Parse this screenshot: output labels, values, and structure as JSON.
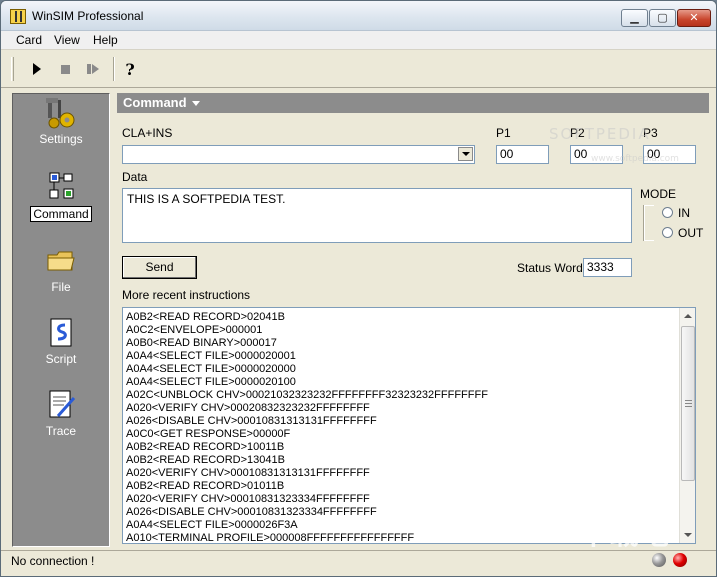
{
  "window": {
    "title": "WinSIM Professional",
    "min_glyph": "▁",
    "max_glyph": "▢",
    "close_glyph": "✕"
  },
  "menu": {
    "items": [
      "Card",
      "View",
      "Help"
    ]
  },
  "toolbar": {
    "buttons": [
      {
        "icon": "play-icon",
        "enabled": true
      },
      {
        "icon": "stop-icon",
        "enabled": false
      },
      {
        "icon": "step-icon",
        "enabled": false
      },
      {
        "icon": "help-icon",
        "enabled": true,
        "glyph": "?"
      }
    ]
  },
  "sidebar": {
    "items": [
      {
        "label": "Settings",
        "icon": "settings-icon",
        "active": false
      },
      {
        "label": "Command",
        "icon": "command-icon",
        "active": true
      },
      {
        "label": "File",
        "icon": "folder-icon",
        "active": false
      },
      {
        "label": "Script",
        "icon": "script-icon",
        "active": false
      },
      {
        "label": "Trace",
        "icon": "trace-icon",
        "active": false
      }
    ]
  },
  "command": {
    "header": "Command",
    "cla_ins_label": "CLA+INS",
    "cla_ins_value": "",
    "p1_label": "P1",
    "p1_value": "00",
    "p2_label": "P2",
    "p2_value": "00",
    "p3_label": "P3",
    "p3_value": "00",
    "data_label": "Data",
    "data_value": "THIS IS A SOFTPEDIA TEST.",
    "mode_label": "MODE",
    "mode_in": "IN",
    "mode_out": "OUT",
    "send_label": "Send",
    "status_word_label": "Status Word",
    "status_word_value": "3333",
    "recent_label": "More recent instructions",
    "recent_lines": [
      "A0B2<READ RECORD>02041B",
      "A0C2<ENVELOPE>000001",
      "A0B0<READ BINARY>000017",
      "A0A4<SELECT FILE>0000020001",
      "A0A4<SELECT FILE>0000020000",
      "A0A4<SELECT FILE>0000020100",
      "A02C<UNBLOCK CHV>00021032323232FFFFFFFF32323232FFFFFFFF",
      "A020<VERIFY CHV>00020832323232FFFFFFFF",
      "A026<DISABLE CHV>00010831313131FFFFFFFF",
      "A0C0<GET RESPONSE>00000F",
      "A0B2<READ RECORD>10011B",
      "A0B2<READ RECORD>13041B",
      "A020<VERIFY CHV>00010831313131FFFFFFFF",
      "A0B2<READ RECORD>01011B",
      "A020<VERIFY CHV>00010831323334FFFFFFFF",
      "A026<DISABLE CHV>00010831323334FFFFFFFF",
      "A0A4<SELECT FILE>0000026F3A",
      "A010<TERMINAL PROFILE>000008FFFFFFFFFFFFFFFF"
    ]
  },
  "status": {
    "text": "No connection !"
  },
  "watermark": {
    "text": "SOFTPEDIA",
    "subtext": "www.softpedia.com",
    "logo_text": "下载吧"
  }
}
